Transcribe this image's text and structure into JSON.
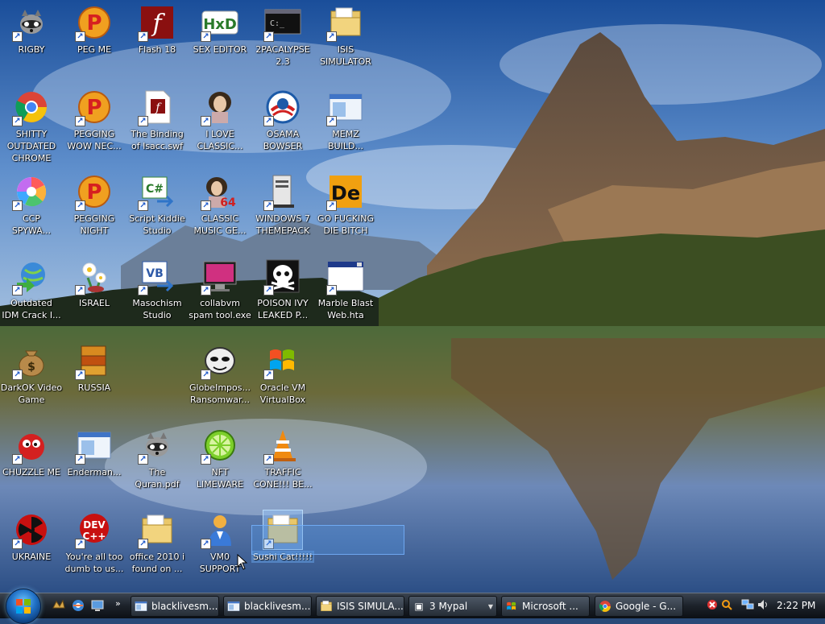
{
  "desktop": {
    "icons": [
      {
        "label": "RIGBY",
        "icon": "raccoon-icon"
      },
      {
        "label": "PEG ME",
        "icon": "p-ball-icon"
      },
      {
        "label": "Flash 18",
        "icon": "flash-icon"
      },
      {
        "label": "SEX EDITOR",
        "icon": "hxd-icon"
      },
      {
        "label": "2PACALYPSE\n2.3",
        "icon": "console-icon"
      },
      {
        "label": "ISIS\nSIMULATOR",
        "icon": "folder-icon"
      },
      {
        "label": "SHITTY\nOUTDATED\nCHROME",
        "icon": "chrome-icon"
      },
      {
        "label": "PEGGING\nWOW NEC...",
        "icon": "p-ball-icon"
      },
      {
        "label": "The Binding\nof Isacc.swf",
        "icon": "swf-file-icon"
      },
      {
        "label": "I LOVE\nCLASSIC...",
        "icon": "portrait-icon"
      },
      {
        "label": "OSAMA\nBOWSER",
        "icon": "obama-logo-icon"
      },
      {
        "label": "MEMZ\nBUILD...",
        "icon": "window-icon"
      },
      {
        "label": "CCP\nSPYWA...",
        "icon": "pinwheel-icon"
      },
      {
        "label": "PEGGING\nNIGHT",
        "icon": "p-ball-icon"
      },
      {
        "label": "Script Kiddie\nStudio",
        "icon": "csharp-icon"
      },
      {
        "label": "CLASSIC\nMUSIC GE...",
        "icon": "portrait-64-icon"
      },
      {
        "label": "WINDOWS 7\nTHEMEPACK",
        "icon": "server-icon"
      },
      {
        "label": "GO FUCKING\nDIE BITCH",
        "icon": "de-icon"
      },
      {
        "label": "Outdated\nIDM Crack I...",
        "icon": "idm-globe-icon"
      },
      {
        "label": "ISRAEL",
        "icon": "flower-icon"
      },
      {
        "label": "Masochism\nStudio",
        "icon": "vb-icon"
      },
      {
        "label": "collabvm\nspam tool.exe",
        "icon": "monitor-icon"
      },
      {
        "label": "POISON IVY\nLEAKED P...",
        "icon": "skull-icon"
      },
      {
        "label": "Marble Blast\nWeb.hta",
        "icon": "hta-window-icon"
      },
      {
        "label": "DarkOK Video\nGame",
        "icon": "money-bag-icon"
      },
      {
        "label": "RUSSIA",
        "icon": "winrar-icon"
      },
      {
        "label": "GlobeImpos...\nRansomwar...",
        "icon": "mask-icon"
      },
      {
        "label": "Oracle VM\nVirtualBox",
        "icon": "windows-flag-icon"
      },
      {
        "label": "CHUZZLE ME",
        "icon": "chuzzle-icon"
      },
      {
        "label": "Enderman...",
        "icon": "window-icon"
      },
      {
        "label": "The\nQuran.pdf",
        "icon": "raccoon-icon"
      },
      {
        "label": "NFT\nLIMEWARE",
        "icon": "lime-icon"
      },
      {
        "label": "TRAFFIC\nCONE!!! BE...",
        "icon": "vlc-cone-icon"
      },
      {
        "label": "UKRAINE",
        "icon": "radiation-icon"
      },
      {
        "label": "You're all too\ndumb to us...",
        "icon": "devcpp-icon"
      },
      {
        "label": "office 2010 i\nfound on ...",
        "icon": "folder-icon"
      },
      {
        "label": "VM0\nSUPPORT",
        "icon": "support-person-icon"
      },
      {
        "label": "Sushi Cat!!!!!",
        "icon": "folder-icon"
      }
    ]
  },
  "taskbar": {
    "start_icon": "windows-start-orb-icon",
    "quick_launch": [
      {
        "icon": "winamp-icon"
      },
      {
        "icon": "browser-icon"
      },
      {
        "icon": "show-desktop-icon"
      }
    ],
    "more_chevron": "»",
    "tasks": [
      {
        "label": "blacklivesm...",
        "icon": "window-icon"
      },
      {
        "label": "blacklivesm...",
        "icon": "window-icon"
      },
      {
        "label": "ISIS SIMULA...",
        "icon": "folder-icon"
      },
      {
        "label": "3  Mypal",
        "icon": "mypal-icon",
        "group": true
      },
      {
        "label": "Microsoft ...",
        "icon": "windows-flag-icon"
      },
      {
        "label": "Google - G...",
        "icon": "chrome-icon"
      }
    ],
    "tray_icons": [
      "close-red-icon",
      "search-orange-icon",
      "network-icon",
      "volume-icon"
    ],
    "clock": "2:22 PM"
  },
  "colors": {
    "label_text": "#ffffff",
    "taskbar_top": "#3b4450",
    "taskbar_bottom": "#0c0f14",
    "selection": "#64a0e6"
  }
}
